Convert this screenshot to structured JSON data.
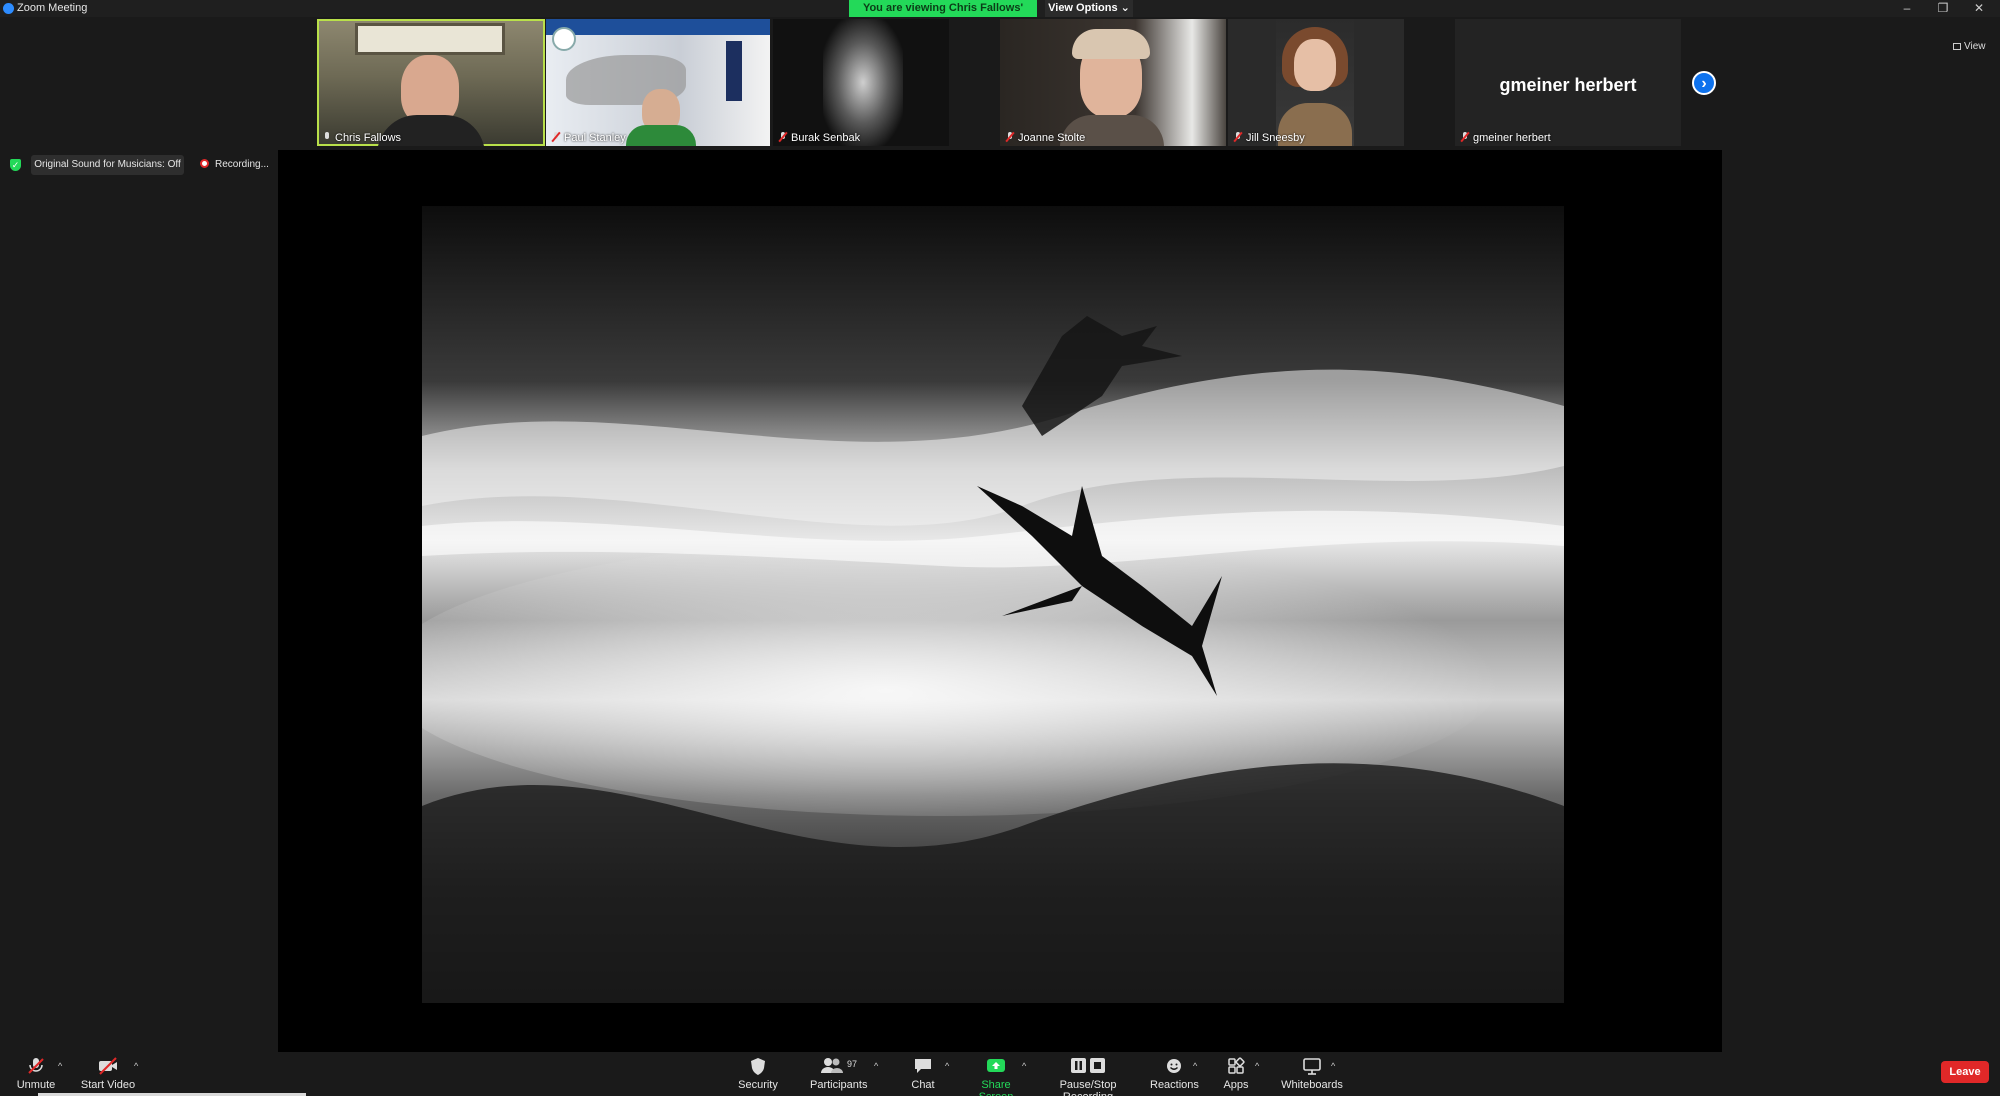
{
  "window": {
    "title": "Zoom Meeting",
    "controls": {
      "minimize": "–",
      "restore": "❐",
      "close": "✕"
    }
  },
  "banner": {
    "viewing_text": "You are viewing Chris Fallows' screen",
    "view_options_label": "View Options ⌄"
  },
  "thumbnails": [
    {
      "name": "Chris Fallows",
      "muted": false
    },
    {
      "name": "Paul Stanley",
      "muted": true
    },
    {
      "name": "Burak Senbak",
      "muted": true
    },
    {
      "name": "Joanne Stolte",
      "muted": true
    },
    {
      "name": "Jill Sneesby",
      "muted": true
    },
    {
      "name": "gmeiner herbert",
      "muted": true,
      "display_name": "gmeiner herbert"
    }
  ],
  "view_button_label": "View",
  "next_page_label": "›",
  "status": {
    "original_sound_label": "Original Sound for Musicians: Off",
    "recording_label": "Recording...",
    "pause_icon": "❚❚",
    "stop_icon": "■"
  },
  "toolbar": {
    "unmute_label": "Unmute",
    "start_video_label": "Start Video",
    "security_label": "Security",
    "participants_label": "Participants",
    "participants_count": "97",
    "chat_label": "Chat",
    "share_screen_label": "Share Screen",
    "recording_label": "Pause/Stop Recording",
    "reactions_label": "Reactions",
    "apps_label": "Apps",
    "whiteboards_label": "Whiteboards",
    "leave_label": "Leave",
    "caret": "^"
  }
}
